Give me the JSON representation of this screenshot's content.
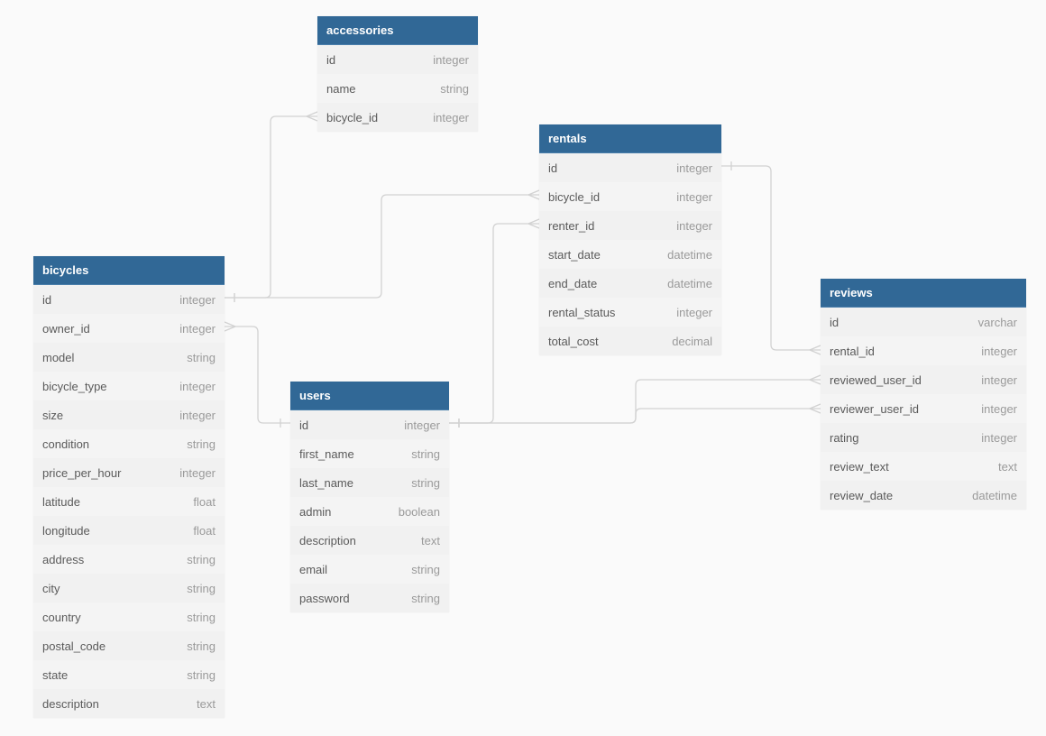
{
  "tables": [
    {
      "name": "accessories",
      "columns": [
        {
          "name": "id",
          "type": "integer"
        },
        {
          "name": "name",
          "type": "string"
        },
        {
          "name": "bicycle_id",
          "type": "integer"
        }
      ]
    },
    {
      "name": "rentals",
      "columns": [
        {
          "name": "id",
          "type": "integer"
        },
        {
          "name": "bicycle_id",
          "type": "integer"
        },
        {
          "name": "renter_id",
          "type": "integer"
        },
        {
          "name": "start_date",
          "type": "datetime"
        },
        {
          "name": "end_date",
          "type": "datetime"
        },
        {
          "name": "rental_status",
          "type": "integer"
        },
        {
          "name": "total_cost",
          "type": "decimal"
        }
      ]
    },
    {
      "name": "bicycles",
      "columns": [
        {
          "name": "id",
          "type": "integer"
        },
        {
          "name": "owner_id",
          "type": "integer"
        },
        {
          "name": "model",
          "type": "string"
        },
        {
          "name": "bicycle_type",
          "type": "integer"
        },
        {
          "name": "size",
          "type": "integer"
        },
        {
          "name": "condition",
          "type": "string"
        },
        {
          "name": "price_per_hour",
          "type": "integer"
        },
        {
          "name": "latitude",
          "type": "float"
        },
        {
          "name": "longitude",
          "type": "float"
        },
        {
          "name": "address",
          "type": "string"
        },
        {
          "name": "city",
          "type": "string"
        },
        {
          "name": "country",
          "type": "string"
        },
        {
          "name": "postal_code",
          "type": "string"
        },
        {
          "name": "state",
          "type": "string"
        },
        {
          "name": "description",
          "type": "text"
        }
      ]
    },
    {
      "name": "users",
      "columns": [
        {
          "name": "id",
          "type": "integer"
        },
        {
          "name": "first_name",
          "type": "string"
        },
        {
          "name": "last_name",
          "type": "string"
        },
        {
          "name": "admin",
          "type": "boolean"
        },
        {
          "name": "description",
          "type": "text"
        },
        {
          "name": "email",
          "type": "string"
        },
        {
          "name": "password",
          "type": "string"
        }
      ]
    },
    {
      "name": "reviews",
      "columns": [
        {
          "name": "id",
          "type": "varchar"
        },
        {
          "name": "rental_id",
          "type": "integer"
        },
        {
          "name": "reviewed_user_id",
          "type": "integer"
        },
        {
          "name": "reviewer_user_id",
          "type": "integer"
        },
        {
          "name": "rating",
          "type": "integer"
        },
        {
          "name": "review_text",
          "type": "text"
        },
        {
          "name": "review_date",
          "type": "datetime"
        }
      ]
    }
  ],
  "relationships": [
    {
      "from": "bicycles.id",
      "to": "accessories.bicycle_id",
      "type": "one-to-many"
    },
    {
      "from": "bicycles.id",
      "to": "rentals.bicycle_id",
      "type": "one-to-many"
    },
    {
      "from": "users.id",
      "to": "bicycles.owner_id",
      "type": "one-to-many"
    },
    {
      "from": "users.id",
      "to": "rentals.renter_id",
      "type": "one-to-many"
    },
    {
      "from": "users.id",
      "to": "reviews.reviewed_user_id",
      "type": "one-to-many"
    },
    {
      "from": "users.id",
      "to": "reviews.reviewer_user_id",
      "type": "one-to-many"
    },
    {
      "from": "rentals.id",
      "to": "reviews.rental_id",
      "type": "one-to-many"
    }
  ],
  "colors": {
    "header": "#316896",
    "background": "#fafafa",
    "connector": "#d2d2d2"
  }
}
